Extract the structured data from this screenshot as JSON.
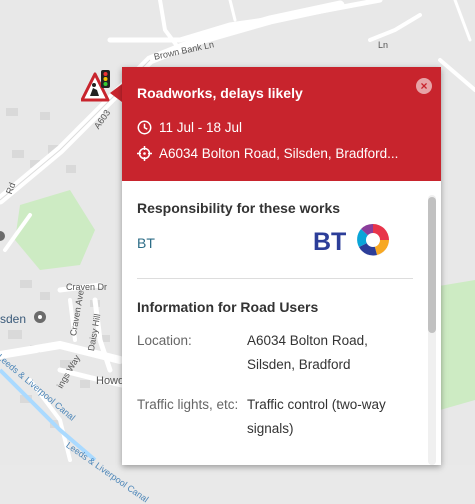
{
  "map": {
    "roads": [
      "Brown Bank Ln",
      "Craven Dr",
      "Craven Ave",
      "Daisy Hill",
      "Howd",
      "Rd",
      "Leeds & Liverpool Canal",
      "Leeds & Liverpool Canal",
      "ings Way",
      "Ln",
      "A603"
    ],
    "place": "sden"
  },
  "popup": {
    "title": "Roadworks, delays likely",
    "close_label": "×",
    "dates": "11 Jul - 18 Jul",
    "location": "A6034 Bolton Road, Silsden, Bradford...",
    "responsibility_title": "Responsibility for these works",
    "responsible_org": "BT",
    "bt_logo_text": "BT",
    "info_title": "Information for Road Users",
    "info_rows": [
      {
        "key": "Location:",
        "value": "A6034 Bolton Road, Silsden, Bradford"
      },
      {
        "key": "Traffic lights, etc:",
        "value": "Traffic control (two-way signals)"
      }
    ]
  },
  "colors": {
    "header": "#c8242d",
    "link": "#2d6d87",
    "park": "#cdebc3",
    "water": "#aadaff"
  }
}
